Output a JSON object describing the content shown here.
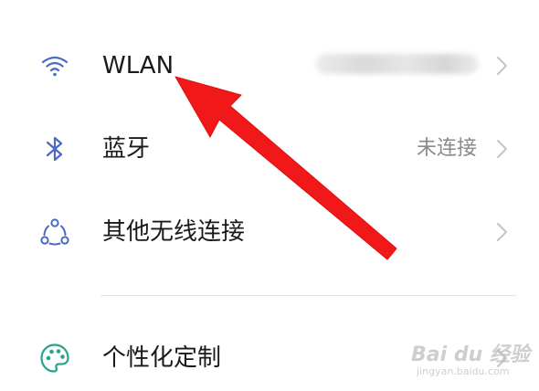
{
  "settings": {
    "items": [
      {
        "label": "WLAN",
        "value": "",
        "icon": "wifi-icon"
      },
      {
        "label": "蓝牙",
        "value": "未连接",
        "icon": "bluetooth-icon"
      },
      {
        "label": "其他无线连接",
        "value": "",
        "icon": "wireless-connections-icon"
      },
      {
        "label": "个性化定制",
        "value": "",
        "icon": "palette-icon"
      }
    ]
  },
  "watermark": {
    "main": "Bai du 经验",
    "sub": "jingyan.baidu.com"
  },
  "colors": {
    "icon_blue": "#4a68c4",
    "icon_green": "#27a58a",
    "arrow_red": "#f01818",
    "text_primary": "#1a1a1a",
    "text_secondary": "#8a8a8a"
  }
}
